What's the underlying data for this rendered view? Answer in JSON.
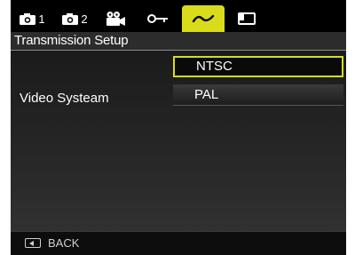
{
  "tabs": [
    {
      "icon": "camera-icon",
      "number": "1",
      "active": false
    },
    {
      "icon": "camera-icon",
      "number": "2",
      "active": false
    },
    {
      "icon": "movie-camera-icon",
      "number": "",
      "active": false
    },
    {
      "icon": "key-icon",
      "number": "",
      "active": false
    },
    {
      "icon": "wave-icon",
      "number": "",
      "active": true
    },
    {
      "icon": "card-icon",
      "number": "",
      "active": false
    }
  ],
  "title": "Transmission Setup",
  "setting_label": "Video Systeam",
  "options": [
    {
      "label": "NTSC",
      "selected": true
    },
    {
      "label": "PAL",
      "selected": false
    }
  ],
  "footer": {
    "back_label": "BACK",
    "back_icon": "back-button-icon"
  },
  "colors": {
    "accent": "#d8dc1a",
    "background": "#000000"
  }
}
